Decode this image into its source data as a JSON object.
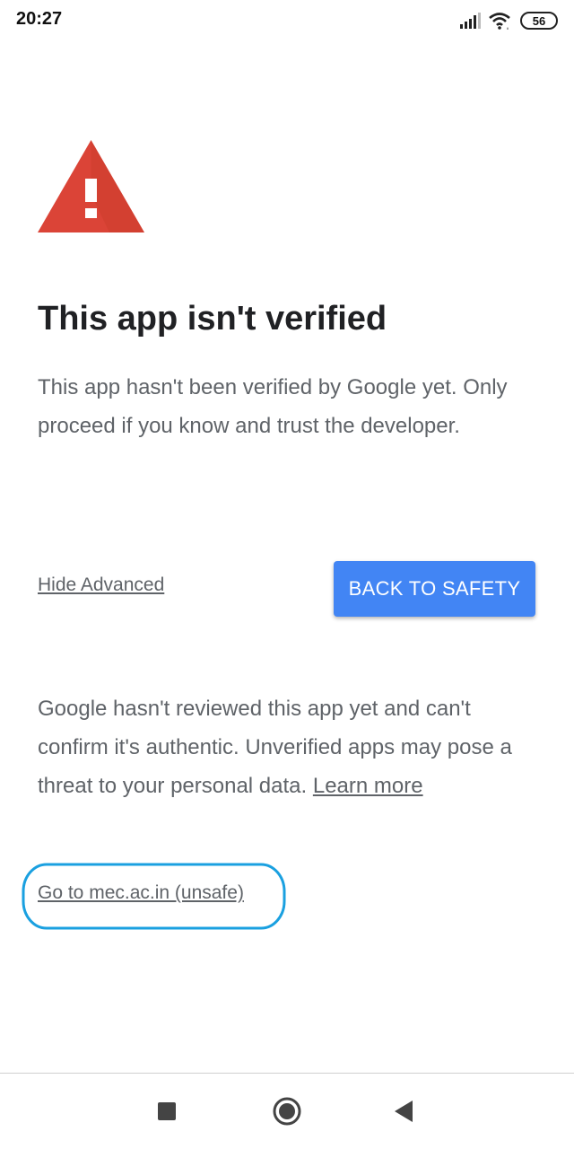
{
  "status_bar": {
    "time": "20:27",
    "battery": "56"
  },
  "warning": {
    "icon": "warning-triangle-icon",
    "color": "#db4437"
  },
  "title": "This app isn't verified",
  "description": "This app hasn't been verified by Google yet. Only proceed if you know and trust the developer.",
  "actions": {
    "hide_advanced": "Hide Advanced",
    "back_to_safety": "BACK TO SAFETY",
    "button_color": "#4285f4"
  },
  "advanced": {
    "text": "Google hasn't reviewed this app yet and can't confirm it's authentic. Unverified apps may pose a threat to your personal data. ",
    "learn_more": "Learn more",
    "go_to_link": "Go to mec.ac.in (unsafe)",
    "highlight_color": "#1aa0e0"
  },
  "nav_bar": {
    "recents_icon": "square-icon",
    "home_icon": "circle-icon",
    "back_icon": "triangle-back-icon"
  }
}
